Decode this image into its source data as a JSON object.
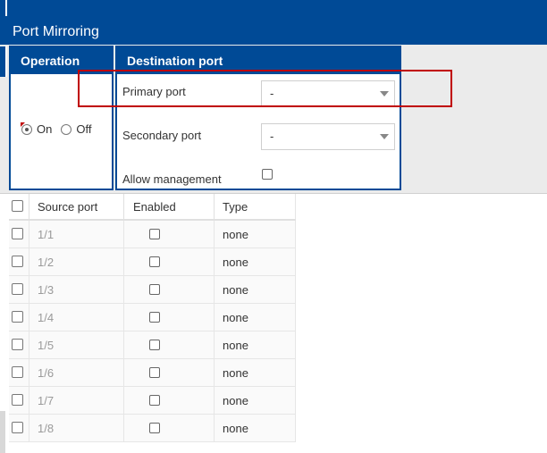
{
  "page": {
    "title": "Port Mirroring"
  },
  "operation": {
    "header": "Operation",
    "on_label": "On",
    "off_label": "Off",
    "selected": "On"
  },
  "destination": {
    "header": "Destination port",
    "primary_label": "Primary port",
    "primary_value": "-",
    "secondary_label": "Secondary port",
    "secondary_value": "-",
    "allow_management_label": "Allow management"
  },
  "table": {
    "columns": [
      "Source port",
      "Enabled",
      "Type"
    ],
    "rows": [
      {
        "port": "1/1",
        "type": "none"
      },
      {
        "port": "1/2",
        "type": "none"
      },
      {
        "port": "1/3",
        "type": "none"
      },
      {
        "port": "1/4",
        "type": "none"
      },
      {
        "port": "1/5",
        "type": "none"
      },
      {
        "port": "1/6",
        "type": "none"
      },
      {
        "port": "1/7",
        "type": "none"
      },
      {
        "port": "1/8",
        "type": "none"
      }
    ]
  },
  "colors": {
    "brand": "#004a96",
    "highlight": "#c00000",
    "background": "#ebebeb"
  }
}
